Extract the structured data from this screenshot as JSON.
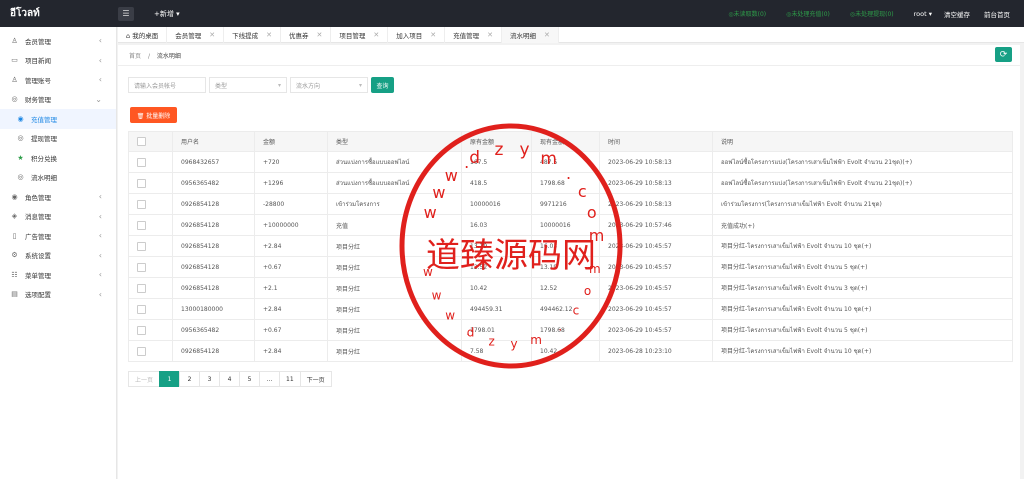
{
  "topbar": {
    "logo": "อีโวลท์",
    "menu_icon": "list-icon",
    "new_label": "+新增 ▾",
    "stats": [
      "◎未读取数(0)",
      "◎未处理充值(0)",
      "◎未处理提现(0)"
    ],
    "user": "root ▾",
    "clear_cache": "清空缓存",
    "frontend": "前台首页"
  },
  "sidebar": {
    "items": [
      {
        "icon": "user-icon",
        "glyph": "♙",
        "label": "会员管理",
        "chev": "‹"
      },
      {
        "icon": "news-icon",
        "glyph": "▭",
        "label": "项目新闻",
        "chev": "‹"
      },
      {
        "icon": "admin-icon",
        "glyph": "♙",
        "label": "管理账号",
        "chev": "‹"
      },
      {
        "icon": "finance-icon",
        "glyph": "◎",
        "label": "财务管理",
        "chev": "⌄"
      },
      {
        "icon": "recharge-icon",
        "glyph": "◉",
        "label": "充值管理",
        "sub": true,
        "active": true
      },
      {
        "icon": "withdraw-icon",
        "glyph": "◎",
        "label": "提现管理",
        "sub": true
      },
      {
        "icon": "points-icon",
        "glyph": "★",
        "label": "积分兑换",
        "sub": true,
        "green": true
      },
      {
        "icon": "flow-icon",
        "glyph": "◎",
        "label": "流水明细",
        "sub": true
      },
      {
        "icon": "role-icon",
        "glyph": "◉",
        "label": "角色管理",
        "chev": "‹"
      },
      {
        "icon": "message-icon",
        "glyph": "◈",
        "label": "消息管理",
        "chev": "‹"
      },
      {
        "icon": "ad-icon",
        "glyph": "▯",
        "label": "广告管理",
        "chev": "‹"
      },
      {
        "icon": "settings-icon",
        "glyph": "⚙",
        "label": "系统设置",
        "chev": "‹"
      },
      {
        "icon": "menu-icon",
        "glyph": "☷",
        "label": "菜单管理",
        "chev": "‹"
      },
      {
        "icon": "config-icon",
        "glyph": "▤",
        "label": "选项配置",
        "chev": "‹"
      }
    ]
  },
  "tabs": [
    {
      "label": "⌂ 我的桌面",
      "close": ""
    },
    {
      "label": "会员管理",
      "close": "✕"
    },
    {
      "label": "下线提成",
      "close": "✕"
    },
    {
      "label": "优惠券",
      "close": "✕"
    },
    {
      "label": "项目管理",
      "close": "✕"
    },
    {
      "label": "加入项目",
      "close": "✕"
    },
    {
      "label": "充值管理",
      "close": "✕"
    },
    {
      "label": "流水明细",
      "close": "✕",
      "active": true
    }
  ],
  "breadcrumb": {
    "home": "首页",
    "sep": "/",
    "current": "流水明细"
  },
  "refresh_icon": "refresh-icon",
  "filters": {
    "account_placeholder": "请输入会员帐号",
    "type_placeholder": "类型",
    "direction_placeholder": "流水方向",
    "search_label": "查询"
  },
  "bulk_delete_label": "🗑 批量删除",
  "table": {
    "headers": [
      "",
      "用户名",
      "金额",
      "类型",
      "原有金额",
      "现有金额",
      "时间",
      "说明"
    ],
    "rows": [
      {
        "user": "0968432657",
        "amount": "+720",
        "type": "ส่วนแบ่งการซื้อแบบออฟไลน์",
        "before": "167.5",
        "after": "487.5",
        "time": "2023-06-29 10:58:13",
        "note": "ออฟไลน์ซื้อโครงการแบ่ง(โครงการเสาเข็มไฟฟ้า Evolt จำนวน 21ชุด)(+)"
      },
      {
        "user": "0956365482",
        "amount": "+1296",
        "type": "ส่วนแบ่งการซื้อแบบออฟไลน์",
        "before": "418.5",
        "after": "1798.68",
        "time": "2023-06-29 10:58:13",
        "note": "ออฟไลน์ซื้อโครงการแบ่ง(โครงการเสาเข็มไฟฟ้า Evolt จำนวน 21ชุด)(+)"
      },
      {
        "user": "0926854128",
        "amount": "-28800",
        "type": "เข้าร่วมโครงการ",
        "before": "10000016",
        "after": "9971216",
        "time": "2023-06-29 10:58:13",
        "note": "เข้าร่วมโครงการ(โครงการเสาเข็มไฟฟ้า Evolt จำนวน 21ชุด)"
      },
      {
        "user": "0926854128",
        "amount": "+10000000",
        "type": "充值",
        "before": "16.03",
        "after": "10000016",
        "time": "2023-06-29 10:57:46",
        "note": "充值成功(+)"
      },
      {
        "user": "0926854128",
        "amount": "+2.84",
        "type": "项目分红",
        "before": "13.19",
        "after": "16.03",
        "time": "2023-06-29 10:45:57",
        "note": "项目分红-โครงการเสาเข็มไฟฟ้า Evolt จำนวน 10 ชุด(+)"
      },
      {
        "user": "0926854128",
        "amount": "+0.67",
        "type": "项目分红",
        "before": "12.52",
        "after": "13.19",
        "time": "2023-06-29 10:45:57",
        "note": "项目分红-โครงการเสาเข็มไฟฟ้า Evolt จำนวน 5 ชุด(+)"
      },
      {
        "user": "0926854128",
        "amount": "+2.1",
        "type": "项目分红",
        "before": "10.42",
        "after": "12.52",
        "time": "2023-06-29 10:45:57",
        "note": "项目分红-โครงการเสาเข็มไฟฟ้า Evolt จำนวน 3 ชุด(+)"
      },
      {
        "user": "13000180000",
        "amount": "+2.84",
        "type": "项目分红",
        "before": "494459.31",
        "after": "494462.12",
        "time": "2023-06-29 10:45:57",
        "note": "项目分红-โครงการเสาเข็มไฟฟ้า Evolt จำนวน 10 ชุด(+)"
      },
      {
        "user": "0956365482",
        "amount": "+0.67",
        "type": "项目分红",
        "before": "1798.01",
        "after": "1798.68",
        "time": "2023-06-29 10:45:57",
        "note": "项目分红-โครงการเสาเข็มไฟฟ้า Evolt จำนวน 5 ชุด(+)"
      },
      {
        "user": "0926854128",
        "amount": "+2.84",
        "type": "项目分红",
        "before": "7.58",
        "after": "10.42",
        "time": "2023-06-28 10:23:10",
        "note": "项目分红-โครงการเสาเข็มไฟฟ้า Evolt จำนวน 10 ชุด(+)"
      }
    ]
  },
  "pagination": [
    "上一页",
    "1",
    "2",
    "3",
    "4",
    "5",
    "…",
    "11",
    "下一页"
  ],
  "stamp": {
    "text": "道臻源码网",
    "top_letters": [
      "d",
      "z",
      "y",
      "m"
    ],
    "bottom_letters": [
      "d",
      "z",
      "y",
      "m"
    ],
    "left_upper": [
      "w",
      "w",
      "w",
      "."
    ],
    "right_upper": [
      ".",
      "c",
      "o",
      "m"
    ],
    "left_lower": [
      "w",
      "w",
      "w",
      "."
    ],
    "right_lower": [
      ".",
      "c",
      "o",
      "m"
    ],
    "color": "#e0201c"
  }
}
